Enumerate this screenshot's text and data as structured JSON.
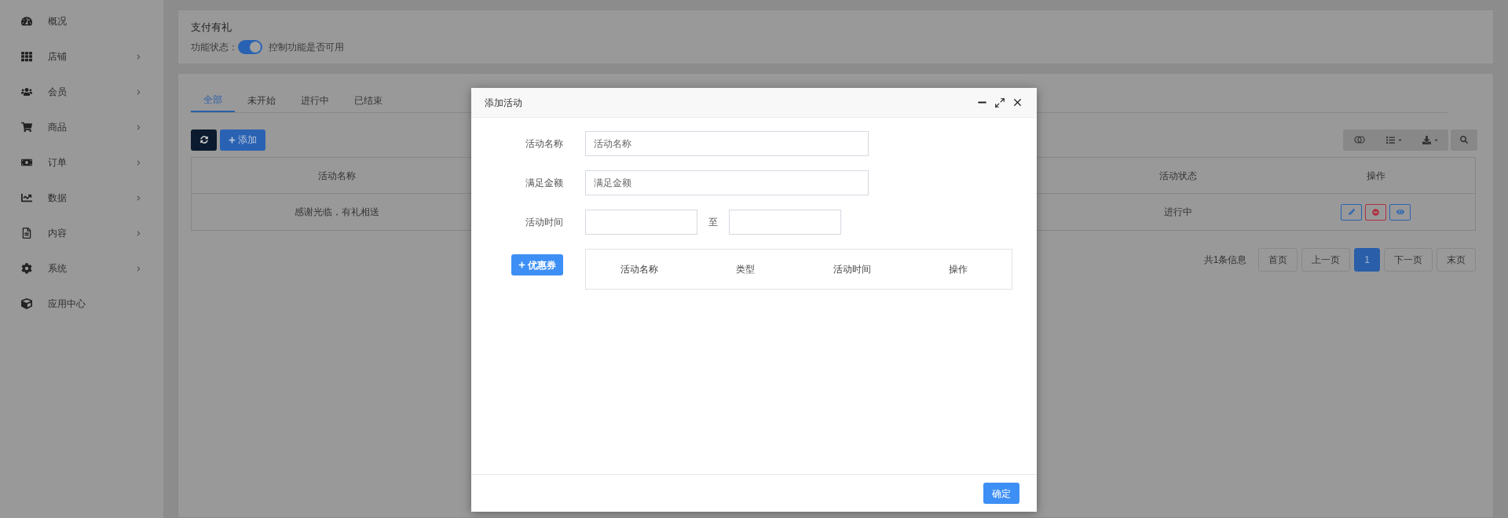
{
  "sidebar": {
    "items": [
      {
        "label": "概况",
        "expandable": false
      },
      {
        "label": "店铺",
        "expandable": true
      },
      {
        "label": "会员",
        "expandable": true
      },
      {
        "label": "商品",
        "expandable": true
      },
      {
        "label": "订单",
        "expandable": true
      },
      {
        "label": "数据",
        "expandable": true
      },
      {
        "label": "内容",
        "expandable": true
      },
      {
        "label": "系统",
        "expandable": true
      },
      {
        "label": "应用中心",
        "expandable": false
      }
    ]
  },
  "feature_card": {
    "title": "支付有礼",
    "status_label": "功能状态：",
    "switch_on": true,
    "hint": "控制功能是否可用"
  },
  "tabs": [
    {
      "label": "全部",
      "selected": true
    },
    {
      "label": "未开始",
      "selected": false
    },
    {
      "label": "进行中",
      "selected": false
    },
    {
      "label": "已结束",
      "selected": false
    }
  ],
  "toolbar": {
    "add_button": "添加"
  },
  "table": {
    "columns": [
      "活动名称",
      "活动状态",
      "操作"
    ],
    "rows": [
      {
        "name": "感谢光临，有礼相送",
        "status": "进行中"
      }
    ]
  },
  "pagination": {
    "summary": "共1条信息",
    "buttons": [
      {
        "label": "首页",
        "selected": false
      },
      {
        "label": "上一页",
        "selected": false
      },
      {
        "label": "1",
        "selected": true
      },
      {
        "label": "下一页",
        "selected": false
      },
      {
        "label": "末页",
        "selected": false
      }
    ]
  },
  "dialog": {
    "title": "添加活动",
    "fields": [
      {
        "label": "活动名称",
        "placeholder": "活动名称"
      },
      {
        "label": "满足金额",
        "placeholder": "满足金额"
      }
    ],
    "time_label": "活动时间",
    "time_separator": "至",
    "coupon_button": "优惠券",
    "coupon_columns": [
      "活动名称",
      "类型",
      "活动时间",
      "操作"
    ],
    "confirm_button": "确定"
  }
}
